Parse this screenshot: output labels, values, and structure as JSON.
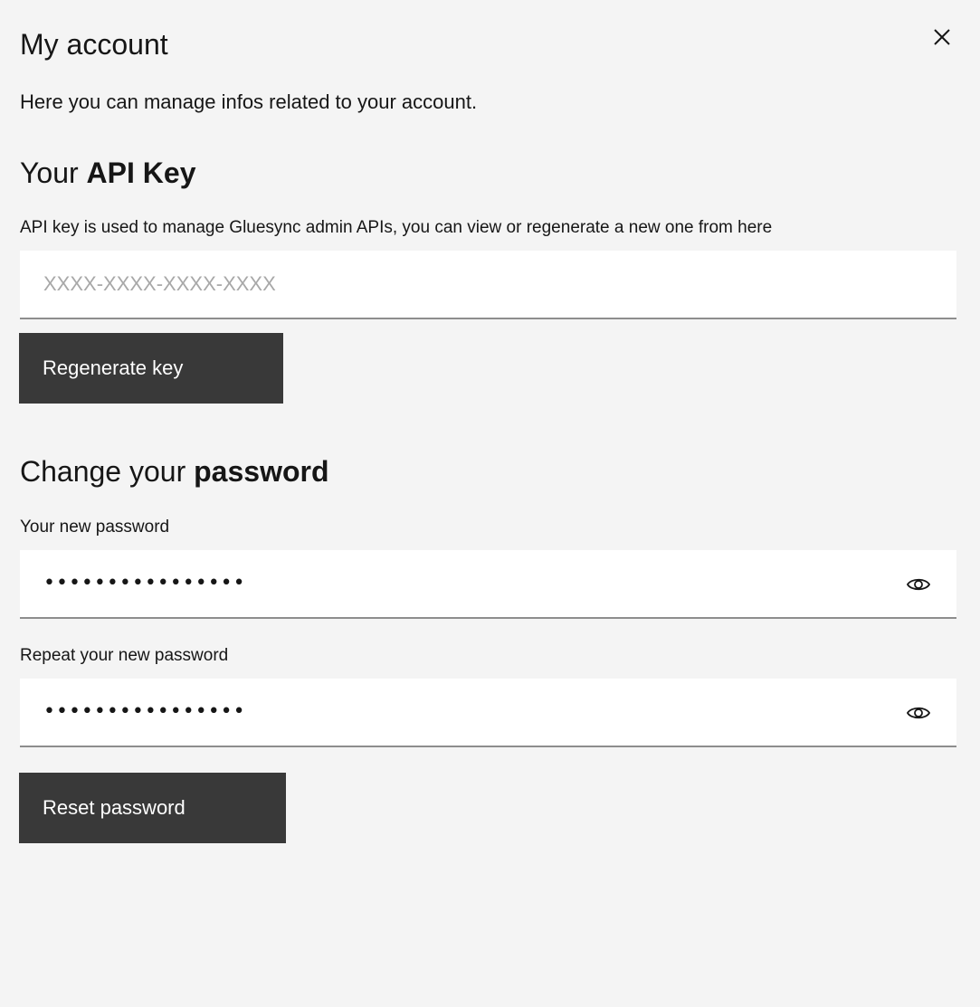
{
  "modal": {
    "title": "My account",
    "subtitle": "Here you can manage infos related to your account."
  },
  "api_key": {
    "heading_prefix": "Your ",
    "heading_bold": "API Key",
    "helper": "API key is used to manage Gluesync admin APIs, you can view or regenerate a new one from here",
    "placeholder": "XXXX-XXXX-XXXX-XXXX",
    "value": "",
    "regenerate_label": "Regenerate key"
  },
  "password": {
    "heading_prefix": "Change your ",
    "heading_bold": "password",
    "new_label": "Your new password",
    "new_value": "••••••••••••••••",
    "repeat_label": "Repeat your new password",
    "repeat_value": "••••••••••••••••",
    "reset_label": "Reset password"
  },
  "icons": {
    "close": "close-icon",
    "show_password": "eye-icon"
  }
}
